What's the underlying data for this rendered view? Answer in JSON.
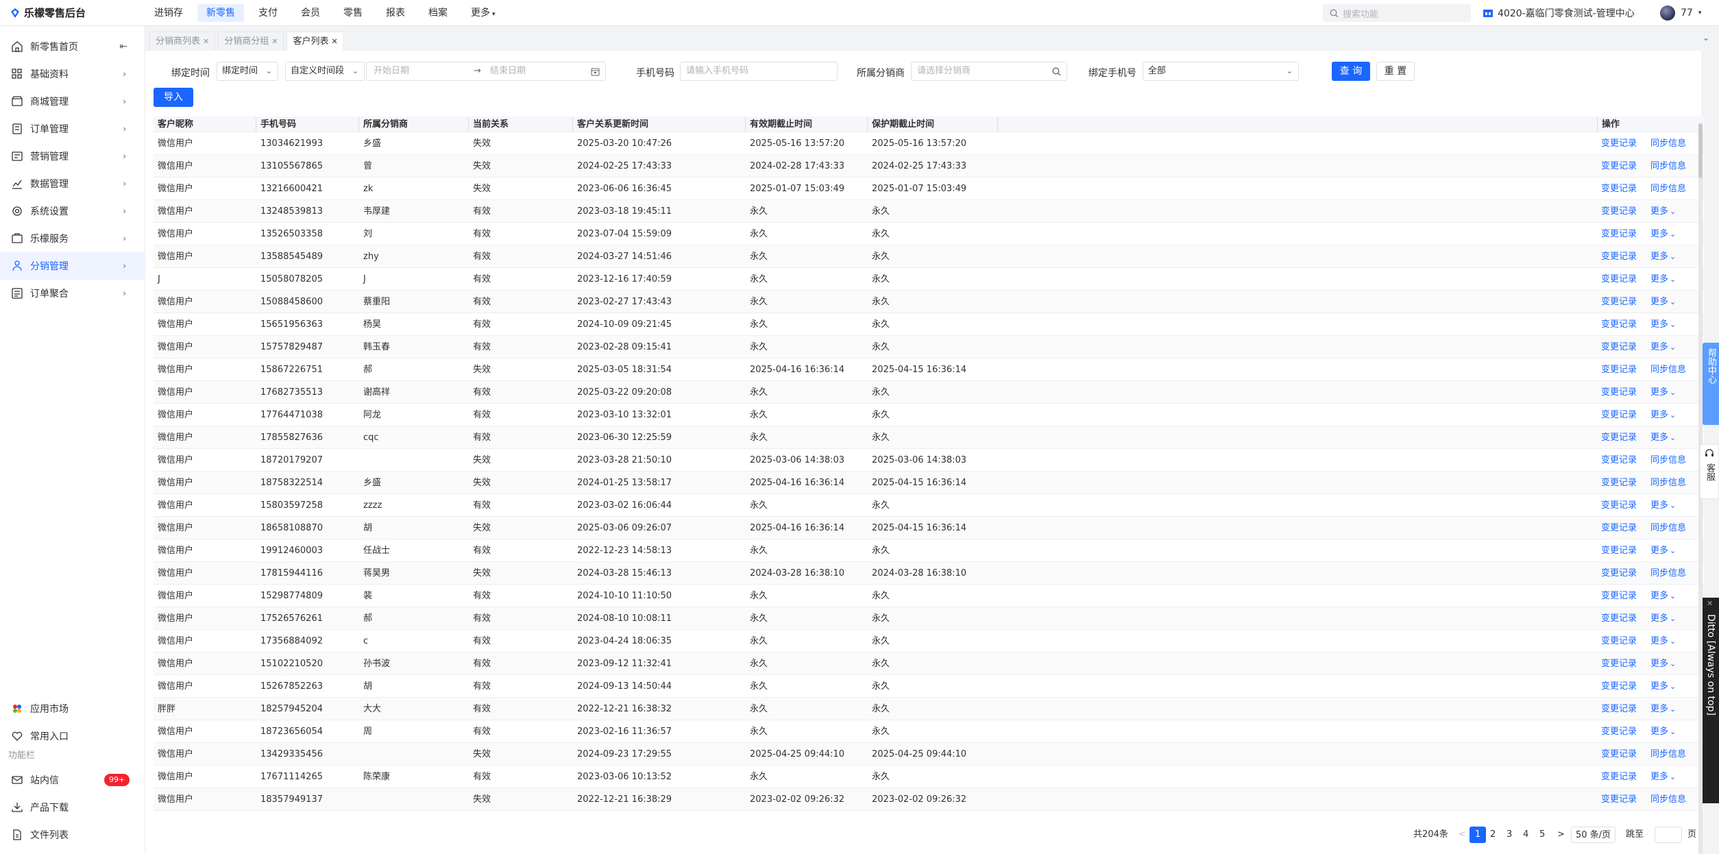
{
  "app": {
    "title": "乐檬零售后台",
    "top_nav": [
      {
        "label": "进销存",
        "active": false
      },
      {
        "label": "新零售",
        "active": true
      },
      {
        "label": "支付",
        "active": false
      },
      {
        "label": "会员",
        "active": false
      },
      {
        "label": "零售",
        "active": false
      },
      {
        "label": "报表",
        "active": false
      },
      {
        "label": "档案",
        "active": false
      },
      {
        "label": "更多",
        "active": false
      }
    ],
    "search_placeholder": "搜索功能",
    "store_name": "4020-嘉临门零食测试-管理中心",
    "user_name": "77"
  },
  "sidebar": {
    "items": [
      {
        "label": "新零售首页",
        "icon": "home-icon"
      },
      {
        "label": "基础资料",
        "icon": "grid-icon"
      },
      {
        "label": "商城管理",
        "icon": "shop-icon"
      },
      {
        "label": "订单管理",
        "icon": "order-icon"
      },
      {
        "label": "营销管理",
        "icon": "marketing-icon"
      },
      {
        "label": "数据管理",
        "icon": "chart-icon"
      },
      {
        "label": "系统设置",
        "icon": "settings-icon"
      },
      {
        "label": "乐檬服务",
        "icon": "service-icon"
      },
      {
        "label": "分销管理",
        "icon": "distribution-icon"
      },
      {
        "label": "订单聚合",
        "icon": "aggregate-icon"
      }
    ],
    "bottom_items": [
      {
        "label": "应用市场",
        "icon": "app-market-icon"
      },
      {
        "label": "常用入口",
        "icon": "heart-icon"
      }
    ],
    "section_label": "功能栏",
    "function_items": [
      {
        "label": "站内信",
        "icon": "mail-icon",
        "badge": "99+"
      },
      {
        "label": "产品下载",
        "icon": "download-icon"
      },
      {
        "label": "文件列表",
        "icon": "file-icon"
      }
    ]
  },
  "tabs": [
    {
      "label": "分销商列表",
      "active": false
    },
    {
      "label": "分销商分组",
      "active": false
    },
    {
      "label": "客户列表",
      "active": true
    }
  ],
  "filters": {
    "bind_time_label": "绑定时间",
    "bind_time_select": "绑定时间",
    "time_range_select": "自定义时间段",
    "start_date_placeholder": "开始日期",
    "end_date_placeholder": "结束日期",
    "range_arrow": "→",
    "phone_label": "手机号码",
    "phone_placeholder": "请输入手机号码",
    "distributor_label": "所属分销商",
    "distributor_placeholder": "请选择分销商",
    "bind_phone_label": "绑定手机号",
    "bind_phone_value": "全部",
    "query_button": "查 询",
    "reset_button": "重 置",
    "import_button": "导入"
  },
  "table": {
    "columns": [
      "客户昵称",
      "手机号码",
      "所属分销商",
      "当前关系",
      "客户关系更新时间",
      "有效期截止时间",
      "保护期截止时间",
      "操作"
    ],
    "action_change_log": "变更记录",
    "action_sync": "同步信息",
    "action_more": "更多",
    "rows": [
      [
        "微信用户",
        "13034621993",
        "乡盛",
        "失效",
        "2025-03-20 10:47:26",
        "2025-05-16 13:57:20",
        "2025-05-16 13:57:20",
        "sync"
      ],
      [
        "微信用户",
        "13105567865",
        "曾",
        "失效",
        "2024-02-25 17:43:33",
        "2024-02-28 17:43:33",
        "2024-02-25 17:43:33",
        "sync"
      ],
      [
        "微信用户",
        "13216600421",
        "zk",
        "失效",
        "2023-06-06 16:36:45",
        "2025-01-07 15:03:49",
        "2025-01-07 15:03:49",
        "sync"
      ],
      [
        "微信用户",
        "13248539813",
        "韦厚建",
        "有效",
        "2023-03-18 19:45:11",
        "永久",
        "永久",
        "more"
      ],
      [
        "微信用户",
        "13526503358",
        "刘",
        "有效",
        "2023-07-04 15:59:09",
        "永久",
        "永久",
        "more"
      ],
      [
        "微信用户",
        "13588545489",
        "zhy",
        "有效",
        "2024-03-27 14:51:46",
        "永久",
        "永久",
        "more"
      ],
      [
        "J",
        "15058078205",
        "J",
        "有效",
        "2023-12-16 17:40:59",
        "永久",
        "永久",
        "more"
      ],
      [
        "微信用户",
        "15088458600",
        "蔡重阳",
        "有效",
        "2023-02-27 17:43:43",
        "永久",
        "永久",
        "more"
      ],
      [
        "微信用户",
        "15651956363",
        "杨昊",
        "有效",
        "2024-10-09 09:21:45",
        "永久",
        "永久",
        "more"
      ],
      [
        "微信用户",
        "15757829487",
        "韩玉春",
        "有效",
        "2023-02-28 09:15:41",
        "永久",
        "永久",
        "more"
      ],
      [
        "微信用户",
        "15867226751",
        "郝",
        "失效",
        "2025-03-05 18:31:54",
        "2025-04-16 16:36:14",
        "2025-04-15 16:36:14",
        "sync"
      ],
      [
        "微信用户",
        "17682735513",
        "谢高祥",
        "有效",
        "2025-03-22 09:20:08",
        "永久",
        "永久",
        "more"
      ],
      [
        "微信用户",
        "17764471038",
        "阿龙",
        "有效",
        "2023-03-10 13:32:01",
        "永久",
        "永久",
        "more"
      ],
      [
        "微信用户",
        "17855827636",
        "cqc",
        "有效",
        "2023-06-30 12:25:59",
        "永久",
        "永久",
        "more"
      ],
      [
        "微信用户",
        "18720179207",
        "",
        "失效",
        "2023-03-28 21:50:10",
        "2025-03-06 14:38:03",
        "2025-03-06 14:38:03",
        "sync"
      ],
      [
        "微信用户",
        "18758322514",
        "乡盛",
        "失效",
        "2024-01-25 13:58:17",
        "2025-04-16 16:36:14",
        "2025-04-15 16:36:14",
        "sync"
      ],
      [
        "微信用户",
        "15803597258",
        "zzzz",
        "有效",
        "2023-03-02 16:06:44",
        "永久",
        "永久",
        "more"
      ],
      [
        "微信用户",
        "18658108870",
        "胡",
        "失效",
        "2025-03-06 09:26:07",
        "2025-04-16 16:36:14",
        "2025-04-15 16:36:14",
        "sync"
      ],
      [
        "微信用户",
        "19912460003",
        "任战士",
        "有效",
        "2022-12-23 14:58:13",
        "永久",
        "永久",
        "more"
      ],
      [
        "微信用户",
        "17815944116",
        "蒋昊男",
        "失效",
        "2024-03-28 15:46:13",
        "2024-03-28 16:38:10",
        "2024-03-28 16:38:10",
        "sync"
      ],
      [
        "微信用户",
        "15298774809",
        "裴",
        "有效",
        "2024-10-10 11:10:50",
        "永久",
        "永久",
        "more"
      ],
      [
        "微信用户",
        "17526576261",
        "郝",
        "有效",
        "2024-08-10 10:08:11",
        "永久",
        "永久",
        "more"
      ],
      [
        "微信用户",
        "17356884092",
        "c",
        "有效",
        "2023-04-24 18:06:35",
        "永久",
        "永久",
        "more"
      ],
      [
        "微信用户",
        "15102210520",
        "孙书波",
        "有效",
        "2023-09-12 11:32:41",
        "永久",
        "永久",
        "more"
      ],
      [
        "微信用户",
        "15267852263",
        "胡",
        "有效",
        "2024-09-13 14:50:44",
        "永久",
        "永久",
        "more"
      ],
      [
        "胖胖",
        "18257945204",
        "大大",
        "有效",
        "2022-12-21 16:38:32",
        "永久",
        "永久",
        "more"
      ],
      [
        "微信用户",
        "18723656054",
        "周",
        "有效",
        "2023-02-16 11:36:57",
        "永久",
        "永久",
        "more"
      ],
      [
        "微信用户",
        "13429335456",
        "",
        "失效",
        "2024-09-23 17:29:55",
        "2025-04-25 09:44:10",
        "2025-04-25 09:44:10",
        "sync"
      ],
      [
        "微信用户",
        "17671114265",
        "陈荣康",
        "有效",
        "2023-03-06 10:13:52",
        "永久",
        "永久",
        "more"
      ],
      [
        "微信用户",
        "18357949137",
        "",
        "失效",
        "2022-12-21 16:38:29",
        "2023-02-02 09:26:32",
        "2023-02-02 09:26:32",
        "sync"
      ]
    ]
  },
  "pagination": {
    "total": "共204条",
    "pages": [
      "1",
      "2",
      "3",
      "4",
      "5"
    ],
    "current": "1",
    "page_size": "50 条/页",
    "jump_label": "跳至",
    "page_suffix": "页",
    "prev": "<",
    "next": ">"
  },
  "floating": {
    "help": "帮助中心",
    "customer_service": "客服",
    "ditto": "Ditto [Always on top]"
  },
  "colors": {
    "accent": "#1a66ff",
    "badge": "#f5222d"
  }
}
